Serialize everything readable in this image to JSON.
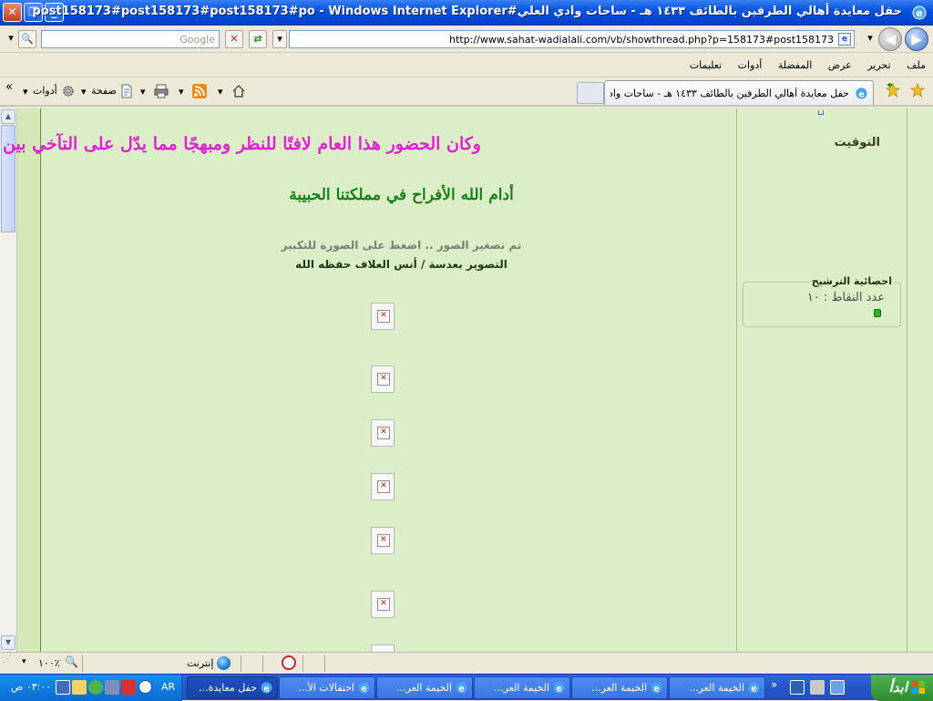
{
  "window": {
    "title": "حفل معايدة أهالي الطرفين بالطائف ١٤٣٣ هـ - ساحات وادي العلي#post158173#post158173#post158173#po - Windows Internet Explorer"
  },
  "address_bar": {
    "url": "http://www.sahat-wadialali.com/vb/showthread.php?p=158173#post158173",
    "search_placeholder": "Google"
  },
  "menu": {
    "items": [
      "ملف",
      "تحرير",
      "عرض",
      "المفضلة",
      "أدوات",
      "تعليمات"
    ]
  },
  "tab": {
    "label": "حفل معايدة أهالي الطرفين بالطائف ١٤٣٣ هـ - ساحات واد..."
  },
  "command_bar": {
    "page_label": "صفحة",
    "tools_label": "أدوات",
    "more": "»"
  },
  "post": {
    "line1": "وكان الحضور هذا العام لافتًا للنظر ومبهجًا مما يدّل على التآخي بين أبناء القرية",
    "line2": "أدام الله الأفراح في مملكتنا الحبيبة",
    "line3": "تم تصغير الصور .. اضغط على الصورة للتكبير",
    "line4": "التصوير بعدسة / أنس العلاف حفظه الله"
  },
  "sidebar": {
    "timing_label": "التوقيت",
    "stats_title": "احصائية الترشيح",
    "points_text": "عدد النقاط : ١٠"
  },
  "status_bar": {
    "zone": "إنترنت",
    "zoom": "١٠٠٪"
  },
  "taskbar": {
    "start_label": "ابدأ",
    "tasks": [
      "الخيمة العر...",
      "الخيمة العر...",
      "الخيمة العر...",
      "الخيمة العر...",
      "احتفالات الأ...",
      "حفل معايدة..."
    ],
    "lang": "AR",
    "clock": "٠٣:٠٠ ص"
  }
}
